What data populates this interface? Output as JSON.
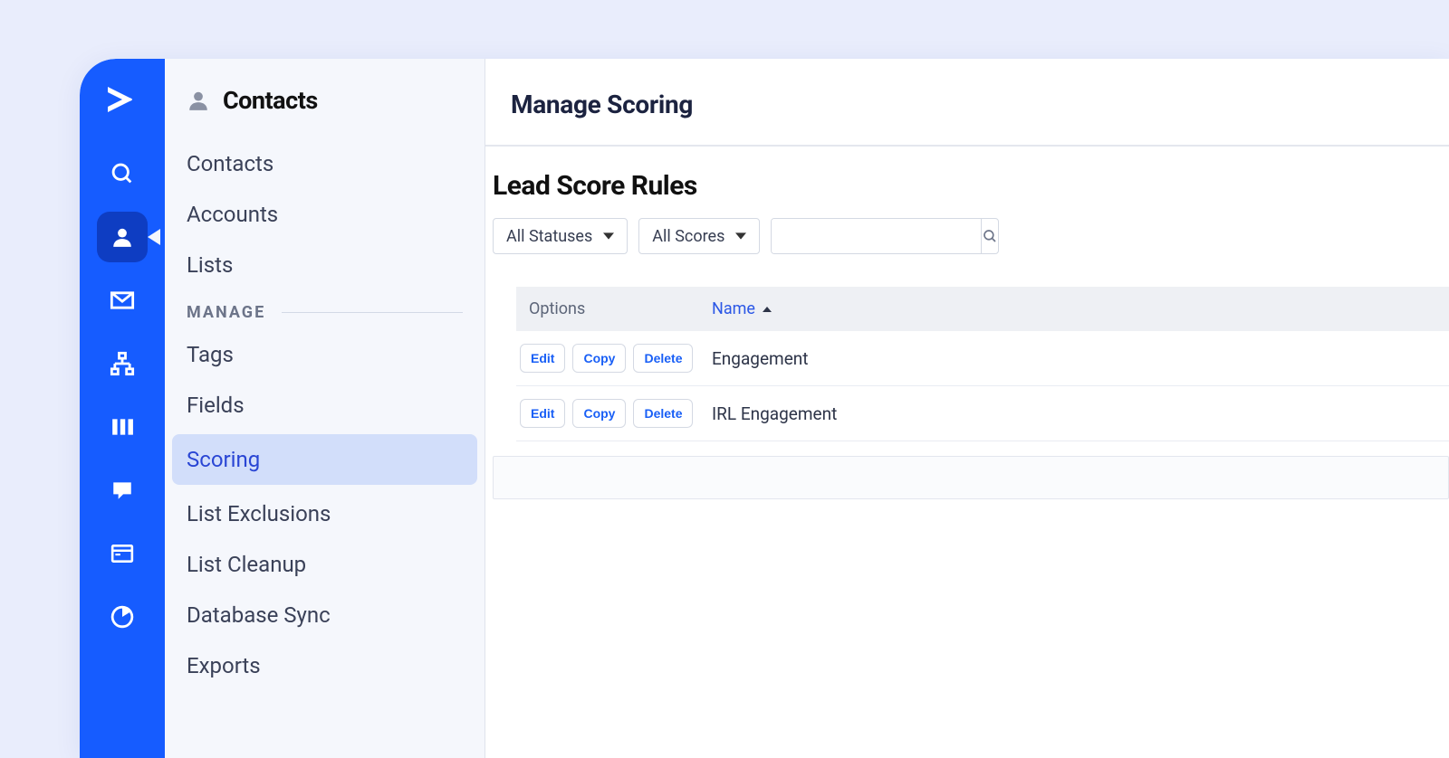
{
  "panel": {
    "title": "Contacts",
    "nav_top": [
      "Contacts",
      "Accounts",
      "Lists"
    ],
    "section_label": "MANAGE",
    "nav_manage": [
      "Tags",
      "Fields",
      "Scoring",
      "List Exclusions",
      "List Cleanup",
      "Database Sync",
      "Exports"
    ],
    "active": "Scoring"
  },
  "main": {
    "header": "Manage Scoring",
    "section_title": "Lead Score Rules",
    "filter_status": "All Statuses",
    "filter_score": "All Scores",
    "search_placeholder": ""
  },
  "table": {
    "col_options": "Options",
    "col_name": "Name",
    "btn_edit": "Edit",
    "btn_copy": "Copy",
    "btn_delete": "Delete",
    "rows": [
      {
        "name": "Engagement"
      },
      {
        "name": "IRL Engagement"
      }
    ]
  }
}
